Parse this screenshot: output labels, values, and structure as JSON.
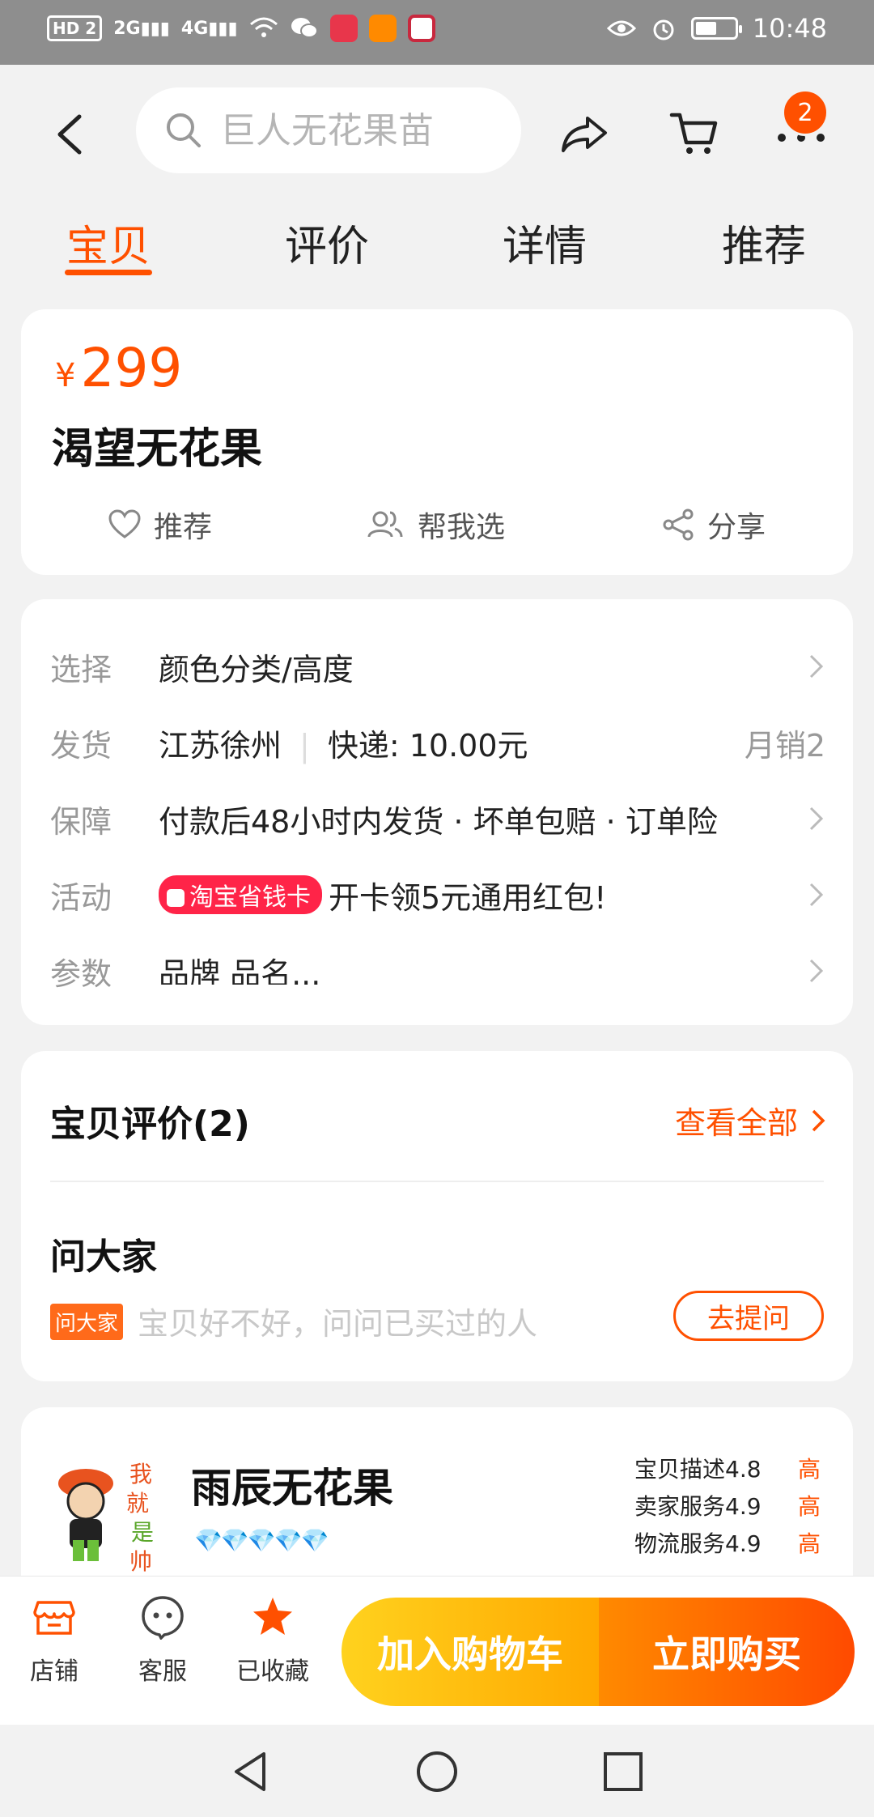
{
  "status_bar": {
    "network": "HD 2",
    "signal1": "2G",
    "signal2": "4G",
    "time": "10:48"
  },
  "header": {
    "search_placeholder": "巨人无花果苗",
    "cart_badge": "2"
  },
  "tabs": [
    "宝贝",
    "评价",
    "详情",
    "推荐"
  ],
  "product": {
    "currency": "¥",
    "price": "299",
    "title": "渴望无花果",
    "actions": {
      "recommend": "推荐",
      "help_choose": "帮我选",
      "share": "分享"
    }
  },
  "specs": {
    "select_label": "选择",
    "select_value": "颜色分类/高度",
    "ship_label": "发货",
    "ship_from": "江苏徐州",
    "ship_fee": "快递: 10.00元",
    "monthly_sales": "月销2",
    "guarantee_label": "保障",
    "guarantee_value": "付款后48小时内发货 · 坏单包赔 · 订单险",
    "promo_label": "活动",
    "promo_tag": "淘宝省钱卡",
    "promo_text": "开卡领5元通用红包!",
    "params_label": "参数",
    "params_value": "品牌 品名..."
  },
  "reviews": {
    "title": "宝贝评价(2)",
    "view_all": "查看全部",
    "ask_title": "问大家",
    "ask_tag": "问大家",
    "ask_hint": "宝贝好不好，问问已买过的人",
    "ask_button": "去提问"
  },
  "store": {
    "logo_text": "我就是帅",
    "name": "雨辰无花果",
    "diamonds": "💎💎💎💎💎",
    "scores": [
      {
        "label": "宝贝描述4.8",
        "level": "高"
      },
      {
        "label": "卖家服务4.9",
        "level": "高"
      },
      {
        "label": "物流服务4.9",
        "level": "高"
      }
    ]
  },
  "bottom_bar": {
    "shop": "店铺",
    "service": "客服",
    "favorited": "已收藏",
    "add_to_cart": "加入购物车",
    "buy_now": "立即购买"
  },
  "colors": {
    "accent": "#ff5000",
    "cart_gradient": [
      "#ffd21e",
      "#ffa800"
    ],
    "buy_gradient": [
      "#ff8a00",
      "#ff4a00"
    ]
  }
}
